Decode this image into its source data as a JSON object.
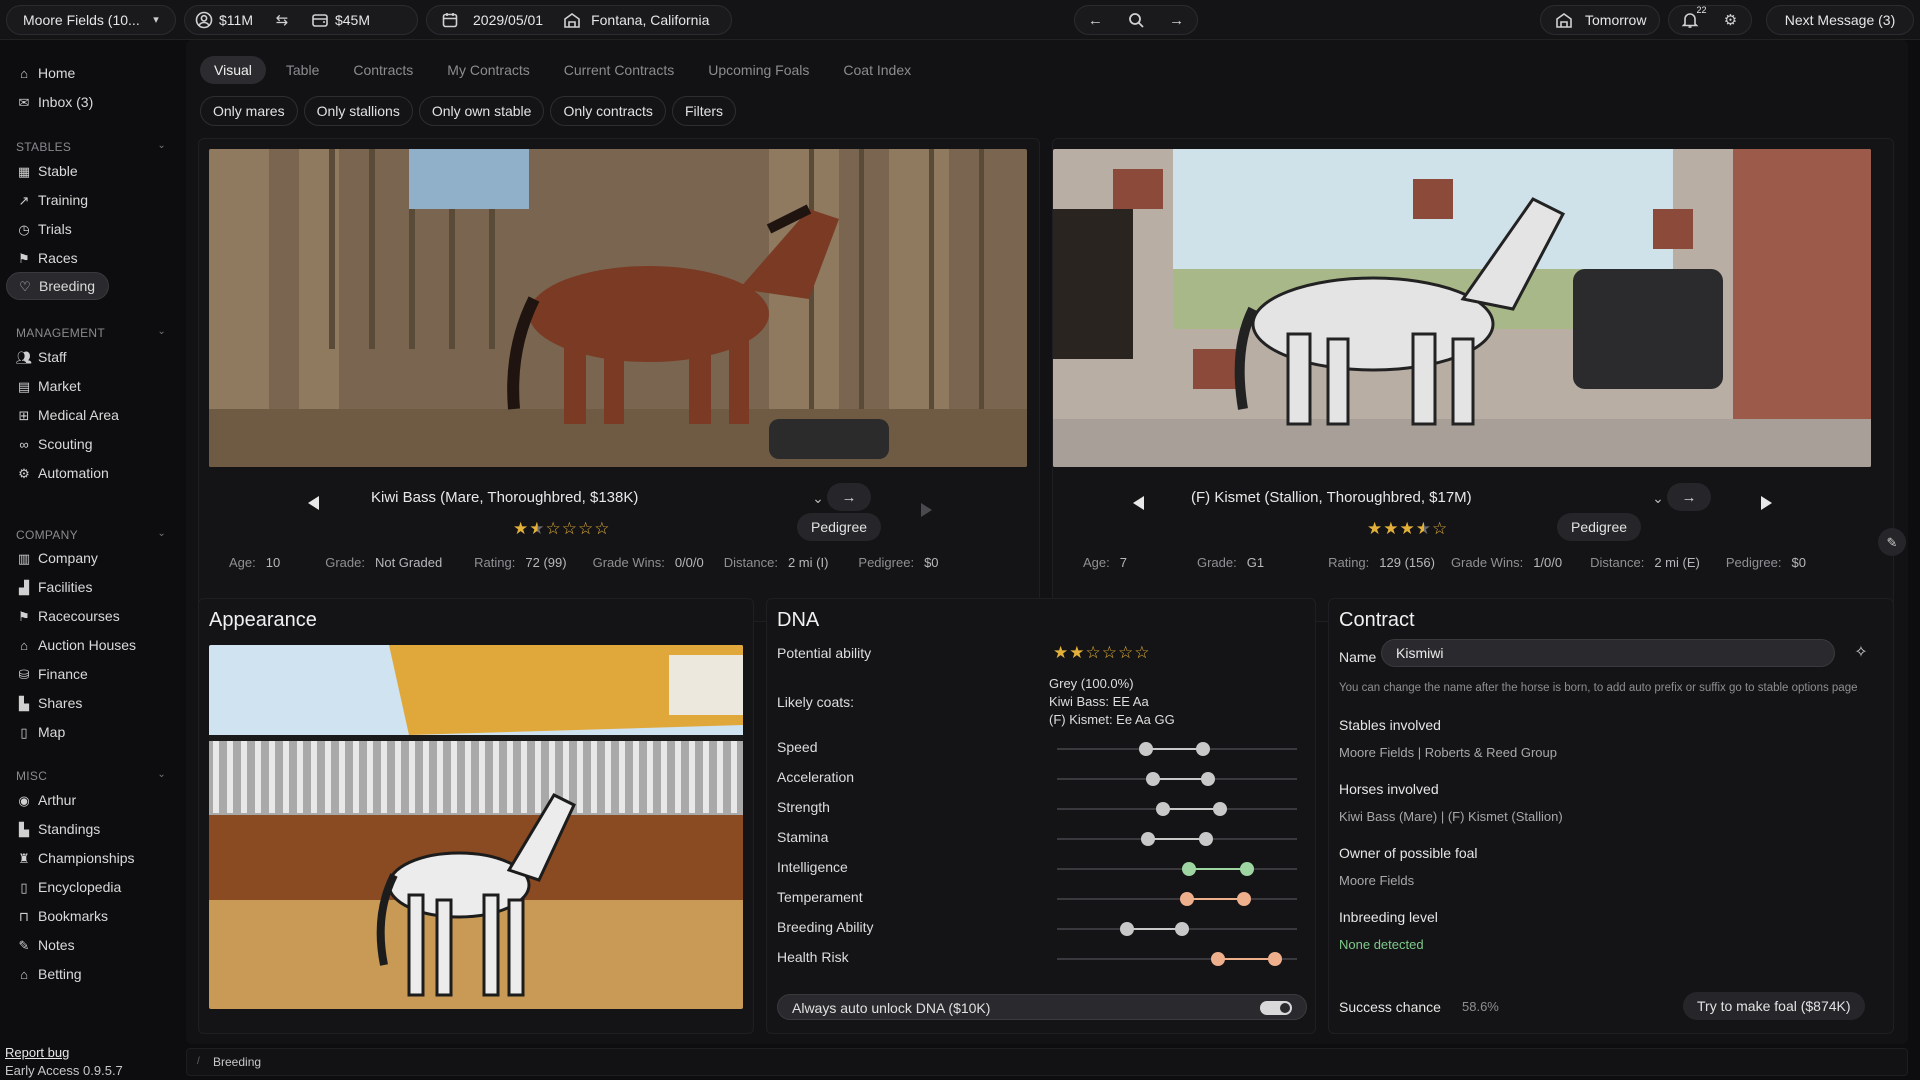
{
  "topbar": {
    "stable_select": "Moore Fields (10...",
    "cash": "$11M",
    "balance": "$45M",
    "date": "2029/05/01",
    "location": "Fontana, California",
    "tomorrow": "Tomorrow",
    "notif_count": "22",
    "next_message": "Next Message (3)"
  },
  "sidebar": {
    "top": [
      {
        "label": "Home",
        "icon": "home-icon"
      },
      {
        "label": "Inbox (3)",
        "icon": "inbox-icon"
      }
    ],
    "stables": {
      "title": "STABLES",
      "items": [
        "Stable",
        "Training",
        "Trials",
        "Races",
        "Breeding"
      ]
    },
    "management": {
      "title": "MANAGEMENT",
      "items": [
        "Staff",
        "Market",
        "Medical Area",
        "Scouting",
        "Automation"
      ]
    },
    "company": {
      "title": "COMPANY",
      "items": [
        "Company",
        "Facilities",
        "Racecourses",
        "Auction Houses",
        "Finance",
        "Shares",
        "Map"
      ]
    },
    "misc": {
      "title": "MISC",
      "items": [
        "Arthur",
        "Standings",
        "Championships",
        "Encyclopedia",
        "Bookmarks",
        "Notes",
        "Betting"
      ]
    },
    "report_bug": "Report bug",
    "version": "Early Access 0.9.5.7"
  },
  "tabs": [
    "Visual",
    "Table",
    "Contracts",
    "My Contracts",
    "Current Contracts",
    "Upcoming Foals",
    "Coat Index"
  ],
  "filters": [
    "Only mares",
    "Only stallions",
    "Only own stable",
    "Only contracts",
    "Filters"
  ],
  "mare": {
    "title": "Kiwi Bass (Mare, Thoroughbred, $138K)",
    "stars": "★★☆☆☆☆",
    "rating_stars": 1.5,
    "pedigree_btn": "Pedigree",
    "age_label": "Age:",
    "age": "10",
    "grade_label": "Grade:",
    "grade": "Not Graded",
    "rating_label": "Rating:",
    "rating": "72 (99)",
    "gradewins_label": "Grade Wins:",
    "gradewins": "0/0/0",
    "distance_label": "Distance:",
    "distance": "2 mi (I)",
    "pedigree_label": "Pedigree:",
    "pedigree": "$0"
  },
  "stallion": {
    "title": "(F) Kismet (Stallion, Thoroughbred, $17M)",
    "rating_stars": 3.5,
    "pedigree_btn": "Pedigree",
    "age_label": "Age:",
    "age": "7",
    "grade_label": "Grade:",
    "grade": "G1",
    "rating_label": "Rating:",
    "rating": "129 (156)",
    "gradewins_label": "Grade Wins:",
    "gradewins": "1/0/0",
    "distance_label": "Distance:",
    "distance": "2 mi (E)",
    "pedigree_label": "Pedigree:",
    "pedigree": "$0"
  },
  "appearance": {
    "title": "Appearance"
  },
  "dna": {
    "title": "DNA",
    "potential_label": "Potential ability",
    "potential_stars": 2,
    "likely_coats_label": "Likely coats:",
    "coats": [
      "Grey (100.0%)",
      "Kiwi Bass: EE Aa",
      "(F) Kismet: Ee Aa GG"
    ],
    "traits": [
      {
        "name": "Speed",
        "min": 0.37,
        "max": 0.61,
        "color": "#c8c8c8"
      },
      {
        "name": "Acceleration",
        "min": 0.4,
        "max": 0.63,
        "color": "#c8c8c8"
      },
      {
        "name": "Strength",
        "min": 0.44,
        "max": 0.68,
        "color": "#c8c8c8"
      },
      {
        "name": "Stamina",
        "min": 0.38,
        "max": 0.62,
        "color": "#c8c8c8"
      },
      {
        "name": "Intelligence",
        "min": 0.55,
        "max": 0.79,
        "color": "#9fd4a3"
      },
      {
        "name": "Temperament",
        "min": 0.54,
        "max": 0.78,
        "color": "#eeb08c"
      },
      {
        "name": "Breeding Ability",
        "min": 0.29,
        "max": 0.52,
        "color": "#c8c8c8"
      },
      {
        "name": "Health Risk",
        "min": 0.67,
        "max": 0.91,
        "color": "#eeb08c"
      }
    ],
    "auto_unlock": "Always auto unlock DNA ($10K)"
  },
  "contract": {
    "title": "Contract",
    "name_label": "Name",
    "name_value": "Kismiwi",
    "name_hint": "You can change the name after the horse is born, to add auto prefix or suffix go to stable options page",
    "stables_label": "Stables involved",
    "stables_value": "Moore Fields | Roberts & Reed Group",
    "horses_label": "Horses involved",
    "horses_value": "Kiwi Bass (Mare) | (F) Kismet (Stallion)",
    "owner_label": "Owner of possible foal",
    "owner_value": "Moore Fields",
    "inbreeding_label": "Inbreeding level",
    "inbreeding_value": "None detected",
    "success_label": "Success chance",
    "success_value": "58.6%",
    "make_foal": "Try to make foal ($874K)"
  },
  "statusbar": {
    "breadcrumb": "Breeding"
  },
  "colors": {
    "star": "#e3b03a",
    "green": "#7fc98a",
    "orange": "#eeb08c"
  }
}
